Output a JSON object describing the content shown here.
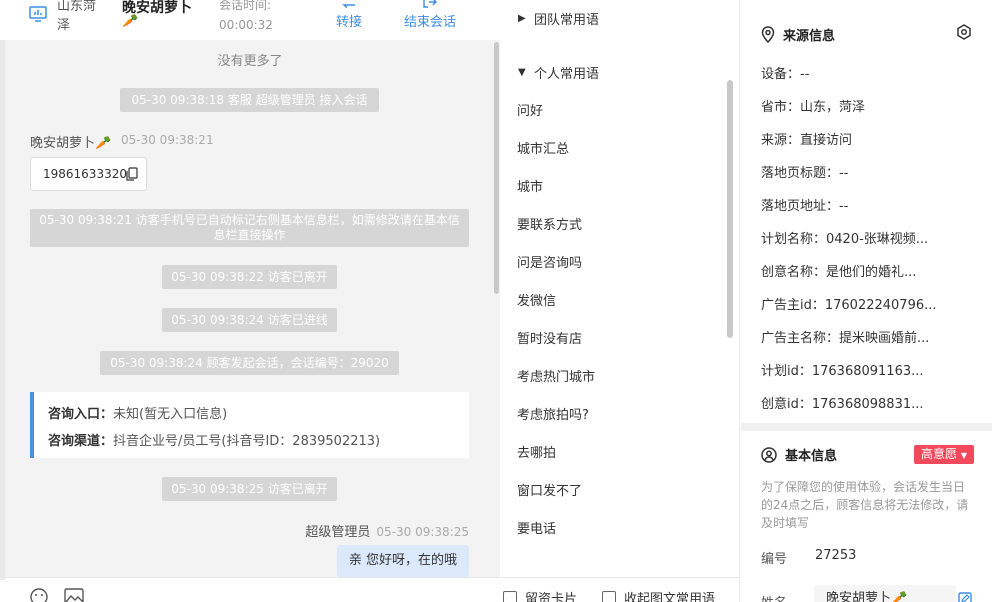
{
  "header": {
    "region": "山东菏泽",
    "visitor_name": "晚安胡萝卜",
    "carrot": "🥕",
    "timer_label": "会话时间:",
    "timer_value": "00:00:32",
    "transfer_label": "转接",
    "end_label": "结束会话"
  },
  "chat": {
    "no_more": "没有更多了",
    "messages": [
      {
        "text": "05-30 09:38:18 客服 超级管理员 接入会话"
      },
      {
        "text": "05-30 09:38:21 访客手机号已自动标记右侧基本信息栏，如需修改请在基本信息栏直接操作"
      },
      {
        "text": "05-30 09:38:22 访客已离开"
      },
      {
        "text": "05-30 09:38:24 访客已进线"
      },
      {
        "text": "05-30 09:38:24 顾客发起会话，会话编号：29020"
      },
      {
        "text": "05-30 09:38:25 访客已离开"
      }
    ],
    "visitor_msg": {
      "name": "晚安胡萝卜🥕",
      "time": "05-30 09:38:21",
      "phone": "19861633320"
    },
    "consult": {
      "entry_label": "咨询入口：",
      "entry_value": "未知(暂无入口信息)",
      "channel_label": "咨询渠道：",
      "channel_value": "抖音企业号/员工号(抖音号ID：2839502213)"
    },
    "agent_msg": {
      "name": "超级管理员",
      "time": "05-30 09:38:25",
      "text": "亲 您好呀，在的哦"
    }
  },
  "phrases": {
    "team_group": "团队常用语",
    "personal_group": "个人常用语",
    "items": [
      "问好",
      "城市汇总",
      "城市",
      "要联系方式",
      "问是咨询吗",
      "发微信",
      "暂时没有店",
      "考虑热门城市",
      "考虑旅拍吗?",
      "去哪拍",
      "窗口发不了",
      "要电话"
    ],
    "footer_left": "留资卡片",
    "footer_right": "收起图文常用语"
  },
  "source_info": {
    "title": "来源信息",
    "rows": [
      "设备：--",
      "省市：山东，菏泽",
      "来源：直接访问",
      "落地页标题：--",
      "落地页地址：--",
      "计划名称：0420-张琳视频...",
      "创意名称：是他们的婚礼...",
      "广告主id：176022240796...",
      "广告主名称：提米映画婚前...",
      "计划id：176368091163...",
      "创意id：176368098831..."
    ]
  },
  "basic_info": {
    "title": "基本信息",
    "intent": "高意愿",
    "note": "为了保障您的使用体验，会话发生当日的24点之后，顾客信息将无法修改，请及时填写",
    "id_label": "编号",
    "id_value": "27253",
    "name_label": "姓名",
    "name_value": "晚安胡萝卜🥕"
  },
  "colors": {
    "accent": "#3a8ee6",
    "intent_badge": "#f2495d",
    "agent_bubble": "#dbe9fb"
  }
}
